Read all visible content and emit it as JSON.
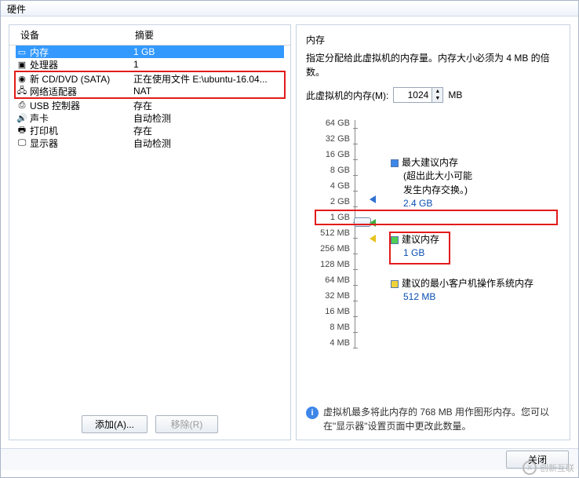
{
  "window": {
    "title": "硬件"
  },
  "list": {
    "header_device": "设备",
    "header_summary": "摘要",
    "rows": [
      {
        "icon": "memory-icon",
        "name": "内存",
        "summary": "1 GB",
        "selected": true
      },
      {
        "icon": "cpu-icon",
        "name": "处理器",
        "summary": "1"
      },
      {
        "icon": "disc-icon",
        "name": "新 CD/DVD (SATA)",
        "summary": "正在使用文件 E:\\ubuntu-16.04..."
      },
      {
        "icon": "network-icon",
        "name": "网络适配器",
        "summary": "NAT"
      },
      {
        "icon": "usb-icon",
        "name": "USB 控制器",
        "summary": "存在"
      },
      {
        "icon": "sound-icon",
        "name": "声卡",
        "summary": "自动检测"
      },
      {
        "icon": "printer-icon",
        "name": "打印机",
        "summary": "存在"
      },
      {
        "icon": "display-icon",
        "name": "显示器",
        "summary": "自动检测"
      }
    ]
  },
  "buttons": {
    "add": "添加(A)...",
    "remove": "移除(R)",
    "close": "关闭"
  },
  "mem": {
    "section_title": "内存",
    "desc": "指定分配给此虚拟机的内存量。内存大小必须为 4 MB 的倍数。",
    "label_this_vm": "此虚拟机的内存(M):",
    "value": "1024",
    "unit": "MB",
    "scale": [
      "64 GB",
      "32 GB",
      "16 GB",
      "8 GB",
      "4 GB",
      "2 GB",
      "1 GB",
      "512 MB",
      "256 MB",
      "128 MB",
      "64 MB",
      "32 MB",
      "16 MB",
      "8 MB",
      "4 MB"
    ],
    "legend": {
      "max_title": "最大建议内存",
      "max_note1": "(超出此大小可能",
      "max_note2": "发生内存交换。)",
      "max_value": "2.4 GB",
      "rec_title": "建议内存",
      "rec_value": "1 GB",
      "min_title": "建议的最小客户机操作系统内存",
      "min_value": "512 MB"
    },
    "footer": "虚拟机最多将此内存的 768 MB 用作图形内存。您可以在\"显示器\"设置页面中更改此数量。"
  },
  "watermark": "创新互联"
}
